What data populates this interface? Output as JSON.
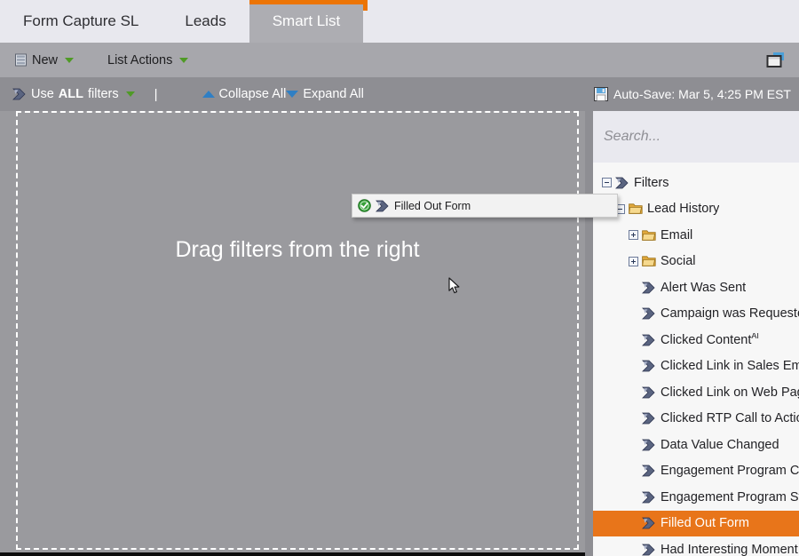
{
  "tabs": [
    {
      "label": "Form Capture SL",
      "active": false
    },
    {
      "label": "Leads",
      "active": false
    },
    {
      "label": "Smart List",
      "active": true
    }
  ],
  "toolbar": {
    "new_label": "New",
    "list_actions_label": "List Actions",
    "new_icon": "database-icon",
    "panel_icon": "panel-layout-icon"
  },
  "filterbar": {
    "use_prefix": "Use ",
    "use_strong": "ALL",
    "use_suffix": " filters",
    "separator": "|",
    "collapse_all": "Collapse All",
    "expand_all": "Expand All",
    "autosave": "Auto-Save: Mar 5, 4:25 PM EST",
    "autosave_icon": "floppy-save-icon",
    "filter_icon": "filter-arrow-icon"
  },
  "canvas": {
    "empty_message": "Drag filters from the right"
  },
  "drag_ghost": {
    "label": "Filled Out Form",
    "status_icon": "green-check-icon",
    "item_icon": "filter-arrow-icon"
  },
  "search": {
    "placeholder": "Search...",
    "value": ""
  },
  "tree": [
    {
      "label": "Filters",
      "indent": 0,
      "toggle": "minus",
      "icon": "filter-arrow-icon",
      "selected": false
    },
    {
      "label": "Lead History",
      "indent": 1,
      "toggle": "minus",
      "icon": "folder-icon",
      "selected": false
    },
    {
      "label": "Email",
      "indent": 2,
      "toggle": "plus",
      "icon": "folder-icon",
      "selected": false
    },
    {
      "label": "Social",
      "indent": 2,
      "toggle": "plus",
      "icon": "folder-icon",
      "selected": false
    },
    {
      "label": "Alert Was Sent",
      "indent": 2,
      "toggle": "none",
      "icon": "filter-arrow-icon",
      "selected": false
    },
    {
      "label": "Campaign was Requested",
      "indent": 2,
      "toggle": "none",
      "icon": "filter-arrow-icon",
      "selected": false
    },
    {
      "label": "Clicked Content",
      "indent": 2,
      "toggle": "none",
      "icon": "filter-arrow-icon",
      "selected": false,
      "superscript": "AI"
    },
    {
      "label": "Clicked Link in Sales Email",
      "indent": 2,
      "toggle": "none",
      "icon": "filter-arrow-icon",
      "selected": false
    },
    {
      "label": "Clicked Link on Web Page",
      "indent": 2,
      "toggle": "none",
      "icon": "filter-arrow-icon",
      "selected": false
    },
    {
      "label": "Clicked RTP Call to Action",
      "indent": 2,
      "toggle": "none",
      "icon": "filter-arrow-icon",
      "selected": false
    },
    {
      "label": "Data Value Changed",
      "indent": 2,
      "toggle": "none",
      "icon": "filter-arrow-icon",
      "selected": false
    },
    {
      "label": "Engagement Program Cadence",
      "indent": 2,
      "toggle": "none",
      "icon": "filter-arrow-icon",
      "selected": false
    },
    {
      "label": "Engagement Program Stream",
      "indent": 2,
      "toggle": "none",
      "icon": "filter-arrow-icon",
      "selected": false
    },
    {
      "label": "Filled Out Form",
      "indent": 2,
      "toggle": "none",
      "icon": "filter-arrow-icon",
      "selected": true
    },
    {
      "label": "Had Interesting Moment",
      "indent": 2,
      "toggle": "none",
      "icon": "filter-arrow-icon",
      "selected": false
    }
  ],
  "colors": {
    "accent_orange": "#ec7404",
    "selection_orange": "#e8751a",
    "toolbar_gray": "#a7a7ac",
    "filterbar_gray": "#8e8e93",
    "canvas_gray": "#9a9a9e",
    "tab_bar": "#e8e8ee",
    "tree_bg": "#f7f7f7",
    "blue_triangle": "#2f7fc4",
    "green_caret": "#4f9a26"
  }
}
